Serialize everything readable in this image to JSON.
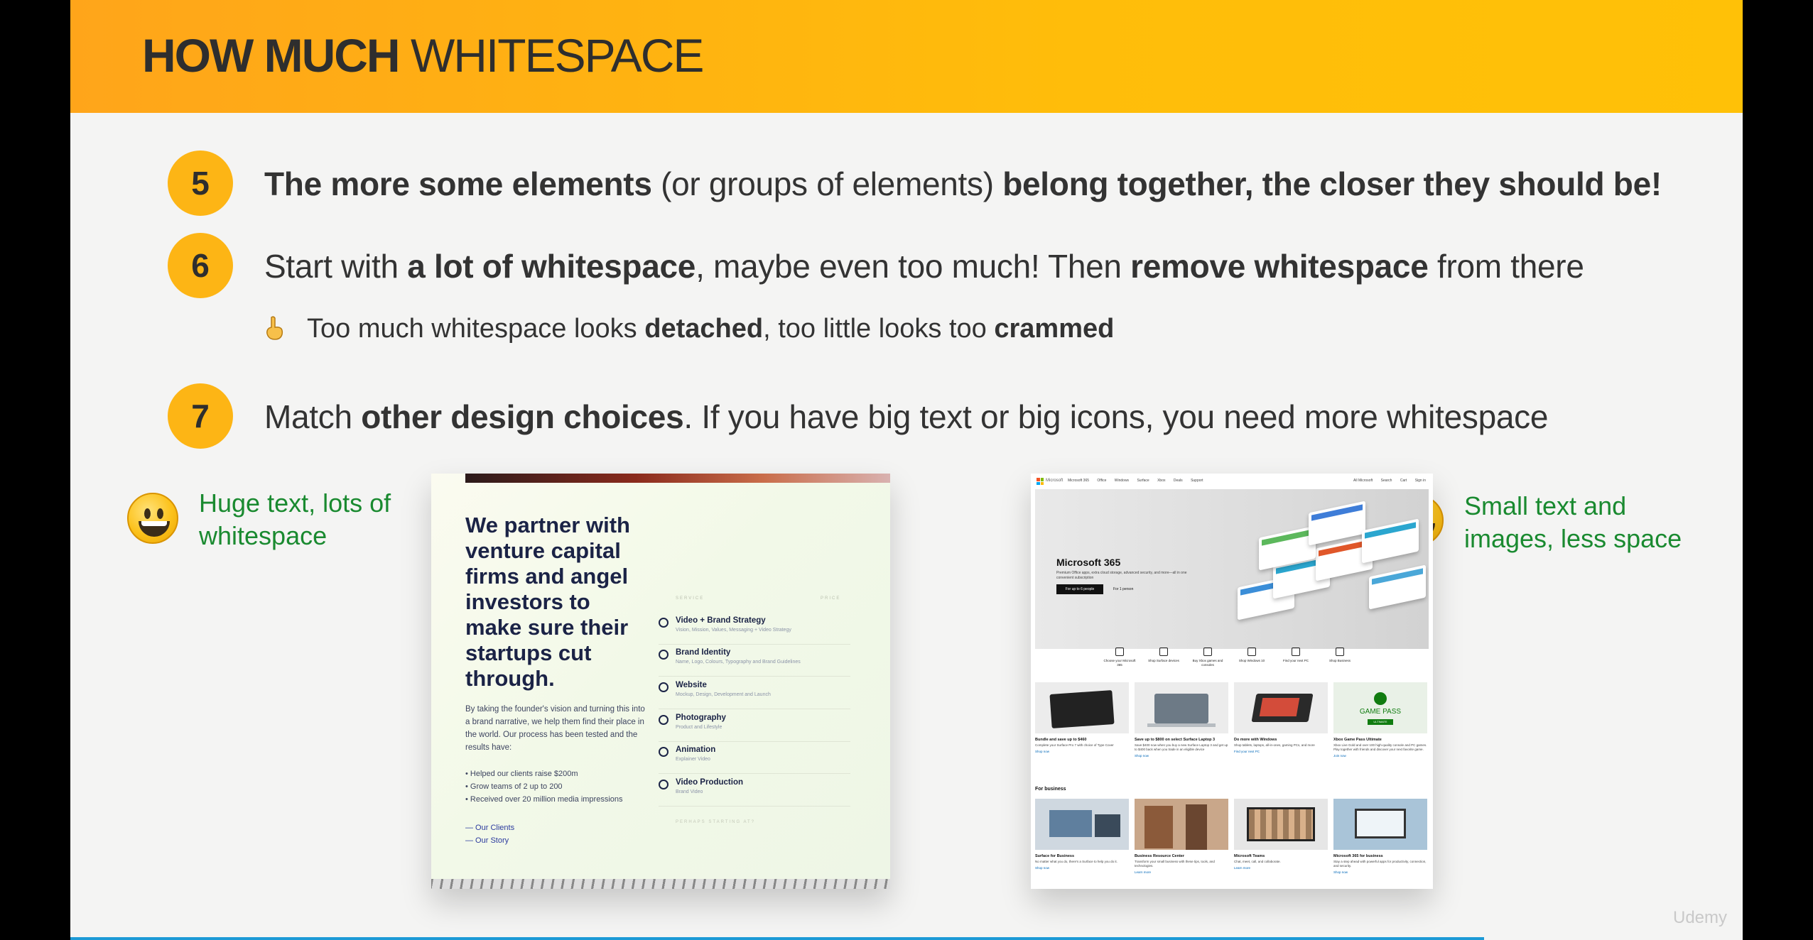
{
  "header": {
    "title_bold": "HOW MUCH",
    "title_light": "WHITESPACE"
  },
  "points": [
    {
      "number": "5",
      "parts": [
        {
          "text": "The more some elements",
          "bold": true
        },
        {
          "text": " (or groups of elements) ",
          "bold": false
        },
        {
          "text": "belong together, the closer they should be!",
          "bold": true
        }
      ]
    },
    {
      "number": "6",
      "parts": [
        {
          "text": "Start with ",
          "bold": false
        },
        {
          "text": "a lot of whitespace",
          "bold": true
        },
        {
          "text": ", maybe even too much! Then ",
          "bold": false
        },
        {
          "text": "remove whitespace",
          "bold": true
        },
        {
          "text": " from there",
          "bold": false
        }
      ]
    },
    {
      "number": "7",
      "parts": [
        {
          "text": "Match ",
          "bold": false
        },
        {
          "text": "other design choices",
          "bold": true
        },
        {
          "text": ". If you have big text or big icons, you need more whitespace",
          "bold": false
        }
      ]
    }
  ],
  "note": {
    "icon": "pointing-up-hand-icon",
    "parts": [
      {
        "text": "Too much whitespace looks ",
        "bold": false
      },
      {
        "text": "detached",
        "bold": true
      },
      {
        "text": ", too little looks too ",
        "bold": false
      },
      {
        "text": "crammed",
        "bold": true
      }
    ]
  },
  "examples": {
    "left_caption_line1": "Huge text, lots of",
    "left_caption_line2": "whitespace",
    "right_caption_line1": "Small text and",
    "right_caption_line2": "images, less space"
  },
  "agency_site": {
    "headline": "We partner with venture capital firms and angel investors to make sure their startups cut through.",
    "body": "By taking the founder's vision and turning this into a brand narrative, we help them find their place in the world. Our process has been tested and the results have:",
    "bullets": [
      "Helped our clients raise $200m",
      "Grow teams of 2 up to 200",
      "Received over 20 million media impressions"
    ],
    "links": [
      "— Our Clients",
      "— Our Story"
    ],
    "services_label": "SERVICE",
    "price_label": "PRICE",
    "services": [
      {
        "title": "Video + Brand Strategy",
        "desc": "Vision, Mission, Values, Messaging + Video Strategy"
      },
      {
        "title": "Brand Identity",
        "desc": "Name, Logo, Colours, Typography and Brand Guidelines"
      },
      {
        "title": "Website",
        "desc": "Mockup, Design, Development and Launch"
      },
      {
        "title": "Photography",
        "desc": "Product and Lifestyle"
      },
      {
        "title": "Animation",
        "desc": "Explainer Video"
      },
      {
        "title": "Video Production",
        "desc": "Brand Video"
      }
    ],
    "footer": "PERHAPS STARTING AT?"
  },
  "microsoft_site": {
    "brand": "Microsoft",
    "nav": [
      "Microsoft 365",
      "Office",
      "Windows",
      "Surface",
      "Xbox",
      "Deals",
      "Support"
    ],
    "nav_right": [
      "All Microsoft",
      "Search",
      "Cart",
      "Sign in"
    ],
    "hero_title": "Microsoft 365",
    "hero_desc": "Premium Office apps, extra cloud storage, advanced security, and more—all in one convenient subscription",
    "hero_btn_primary": "For up to 6 people",
    "hero_btn_secondary": "For 1 person",
    "categories": [
      "Choose your Microsoft 365",
      "Shop Surface devices",
      "Buy Xbox games and consoles",
      "Shop Windows 10",
      "Find your next PC",
      "Shop Business"
    ],
    "tiles": [
      {
        "title": "Bundle and save up to $460",
        "desc": "Complete your Surface Pro 7 with choice of Type Cover",
        "link": "Shop now"
      },
      {
        "title": "Save up to $800 on select Surface Laptop 3",
        "desc": "Save $400 now when you buy a new Surface Laptop 3 and get up to $400 back when you trade in an eligible device",
        "link": "Shop now"
      },
      {
        "title": "Do more with Windows",
        "desc": "Shop tablets, laptops, all-in-ones, gaming PCs, and more",
        "link": "Find your next PC"
      },
      {
        "title": "Xbox Game Pass Ultimate",
        "desc": "Xbox Live Gold and over 100 high-quality console and PC games. Play together with friends and discover your next favorite game.",
        "link": "Join now"
      }
    ],
    "game_pass_label": "GAME PASS",
    "game_pass_sub": "ULTIMATE",
    "for_business": "For business",
    "business_tiles": [
      {
        "title": "Surface for Business",
        "desc": "No matter what you do, there's a Surface to help you do it.",
        "link": "Shop now"
      },
      {
        "title": "Business Resource Center",
        "desc": "Transform your small business with these tips, tools, and technologies.",
        "link": "Learn more"
      },
      {
        "title": "Microsoft Teams",
        "desc": "Chat, meet, call, and collaborate.",
        "link": "Learn more"
      },
      {
        "title": "Microsoft 365 for business",
        "desc": "Stay a step ahead with powerful apps for productivity, connection, and security.",
        "link": "Shop now"
      }
    ]
  },
  "watermark": "Udemy",
  "colors": {
    "header": "#ffb20f",
    "number_badge": "#fdb515",
    "caption_green": "#1a8a30",
    "progress": "#1c9ad6"
  }
}
